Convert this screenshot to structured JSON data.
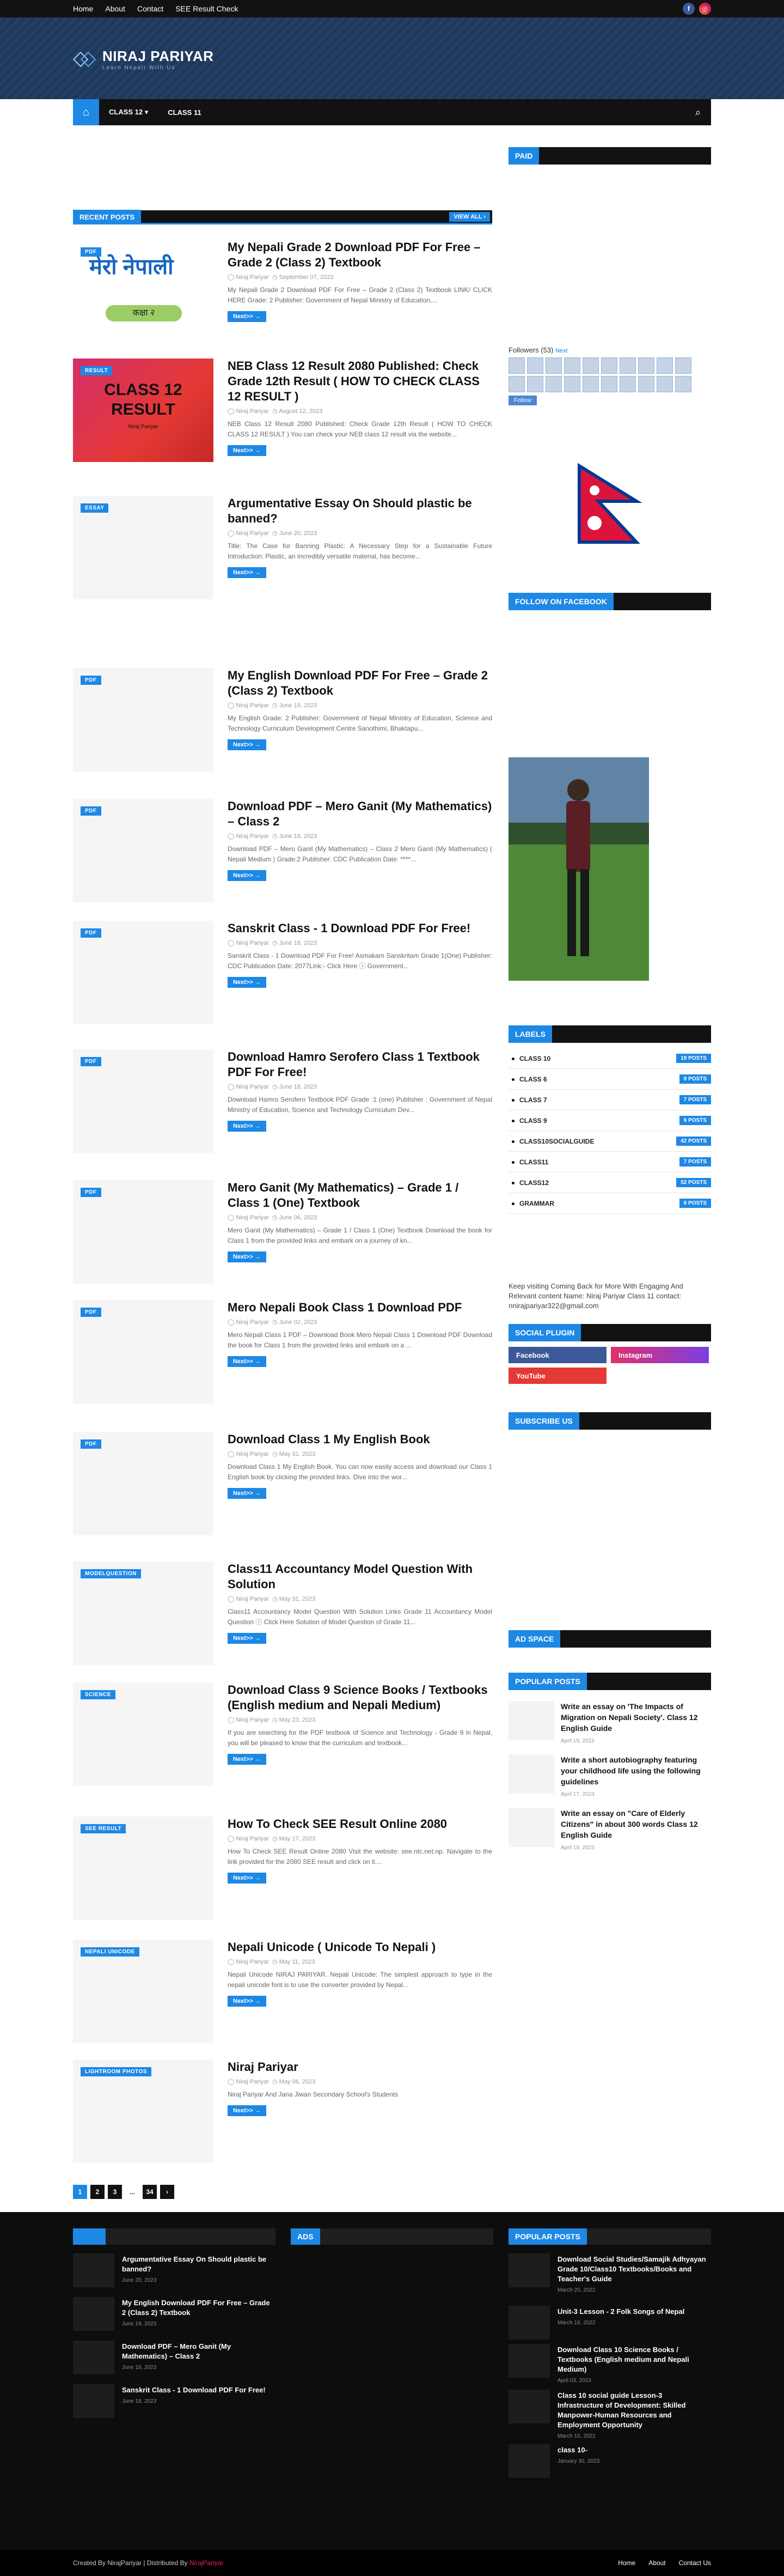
{
  "topbar": {
    "links": [
      "Home",
      "About",
      "Contact",
      "SEE Result Check"
    ],
    "social": [
      "facebook-icon",
      "instagram-icon"
    ]
  },
  "header": {
    "title": "NIRAJ PARIYAR",
    "subtitle": "Learn Nepali With Us"
  },
  "nav": {
    "items": [
      "CLASS 12 ▾",
      "CLASS 11"
    ]
  },
  "main": {
    "section_title": "RECENT POSTS",
    "view_all": "VIEW ALL ›",
    "next_label": "Next>> →",
    "posts": [
      {
        "cat": "PDF",
        "title": "My Nepali Grade 2 Download PDF For Free – Grade 2 (Class 2) Textbook",
        "author": "Niraj Pariyar",
        "date": "September 07, 2023",
        "snippet": "My Nepali Grade 2 Download PDF For Free – Grade 2 (Class 2) Textbook LINK/ CLICK HERE Grade: 2 Publisher: Government of Nepal Ministry of Education,...",
        "thumb_text": "मेरो नेपाली",
        "thumb_sub": "कक्षा २"
      },
      {
        "cat": "RESULT",
        "title": "NEB Class 12 Result 2080 Published: Check Grade 12th Result ( HOW TO CHECK CLASS 12 RESULT )",
        "author": "Niraj Pariyar",
        "date": "August 12, 2023",
        "snippet": "NEB Class 12 Result 2080 Published: Check Grade 12th Result ( HOW TO CHECK CLASS 12 RESULT ) You can check your NEB class 12 result via the website...",
        "thumb_text": "CLASS 12 RESULT",
        "thumb_sub": "Niraj Pariyar"
      },
      {
        "cat": "ESSAY",
        "title": "Argumentative Essay On Should plastic be banned?",
        "author": "Niraj Pariyar",
        "date": "June 20, 2023",
        "snippet": "Title: The Case for Banning Plastic: A Necessary Step for a Sustainable Future Introduction: Plastic, an incredibly versatile material, has become..."
      },
      {
        "cat": "PDF",
        "title": "My English Download PDF For Free – Grade 2 (Class 2) Textbook",
        "author": "Niraj Pariyar",
        "date": "June 19, 2023",
        "snippet": "My English Grade: 2 Publisher: Government of Nepal Ministry of Education, Science and Technology Curriculum Development Centre Sanothimi, Bhaktapu..."
      },
      {
        "cat": "PDF",
        "title": "Download PDF – Mero Ganit (My Mathematics) – Class 2",
        "author": "Niraj Pariyar",
        "date": "June 18, 2023",
        "snippet": "Download PDF – Mero Ganit (My Mathematics) – Class 2 Mero Ganit (My Mathematics) ( Nepali Medium ) Grade:2 Publisher: CDC Publication Date: ****..."
      },
      {
        "cat": "PDF",
        "title": "Sanskrit Class - 1 Download PDF For Free!",
        "author": "Niraj Pariyar",
        "date": "June 18, 2023",
        "snippet": "Sanskrit Class - 1 Download PDF For Free! Asmakam Sanskritam Grade 1(One) Publisher: CDC Publication Date: 2077Link:- Click Here ⓘ Government..."
      },
      {
        "cat": "PDF",
        "title": "Download Hamro Serofero Class 1 Textbook PDF For Free!",
        "author": "Niraj Pariyar",
        "date": "June 18, 2023",
        "snippet": "Download Hamro Serofero Textbook PDF Grade :1 (one) Publisher : Government of Nepal Ministry of Education, Science and Technology Curriculum Dev..."
      },
      {
        "cat": "PDF",
        "title": "Mero Ganit (My Mathematics) – Grade 1 / Class 1 (One) Textbook",
        "author": "Niraj Pariyar",
        "date": "June 06, 2023",
        "snippet": "Mero Ganit (My Mathematics) – Grade 1 / Class 1 (One) Textbook Download the book for Class 1 from the provided links and embark on a journey of kn..."
      },
      {
        "cat": "PDF",
        "title": "Mero Nepali Book Class 1 Download PDF",
        "author": "Niraj Pariyar",
        "date": "June 02, 2023",
        "snippet": "Mero Nepali Class 1 PDF – Download Book Mero Nepali Class 1 Download PDF Download the book for Class 1 from the provided links and embark on a ..."
      },
      {
        "cat": "PDF",
        "title": "Download Class 1 My English Book",
        "author": "Niraj Pariyar",
        "date": "May 31, 2023",
        "snippet": "Download Class 1 My English Book. You can now easily access and download our Class 1 English book by clicking the provided links. Dive into the wor..."
      },
      {
        "cat": "MODELQUESTION",
        "title": "Class11 Accountancy Model Question With Solution",
        "author": "Niraj Pariyar",
        "date": "May 31, 2023",
        "snippet": "Class11 Accountancy Model Question With Solution Links Grade 11 Accountancy Model Question ⓘ Click Here Solution of Model Question of Grade 11..."
      },
      {
        "cat": "SCIENCE",
        "title": "Download Class 9 Science Books / Textbooks (English medium and Nepali Medium)",
        "author": "Niraj Pariyar",
        "date": "May 23, 2023",
        "snippet": "If you are searching for the PDF textbook of Science and Technology - Grade 9 in Nepal, you will be pleased to know that the curriculum and textbook..."
      },
      {
        "cat": "SEE RESULT",
        "title": "How To Check SEE Result Online 2080",
        "author": "Niraj Pariyar",
        "date": "May 17, 2023",
        "snippet": "How To Check SEE Result Online 2080 Visit the website: see.ntc.net.np. Navigate to the link provided for the 2080 SEE result and click on it...."
      },
      {
        "cat": "NEPALI UNICODE",
        "title": "Nepali Unicode ( Unicode To Nepali )",
        "author": "Niraj Pariyar",
        "date": "May 11, 2023",
        "snippet": "Nepali Unicode NIRAJ PARIYAR. Nepali Unicode: The simplest approach to type in the nepali unicode font is to use the converter provided by Nepal..."
      },
      {
        "cat": "LIGHTROOM PHOTOS",
        "title": "Niraj Pariyar",
        "author": "Niraj Pariyar",
        "date": "May 06, 2023",
        "snippet": "Niraj Pariyar And Jana Jiwan Secondary School's Students"
      }
    ],
    "pagination": [
      "1",
      "2",
      "3",
      "...",
      "34",
      "›"
    ]
  },
  "sidebar": {
    "paid": "PAID",
    "followers_title": "Followers (53)",
    "followers_next": "Next",
    "follow_btn": "Follow",
    "fb_title": "FOLLOW ON FACEBOOK",
    "labels_title": "LABELS",
    "labels": [
      {
        "name": "CLASS 10",
        "count": "19 POSTS"
      },
      {
        "name": "CLASS 6",
        "count": "8 POSTS"
      },
      {
        "name": "CLASS 7",
        "count": "7 POSTS"
      },
      {
        "name": "CLASS 9",
        "count": "6 POSTS"
      },
      {
        "name": "CLASS10SOCIALGUIDE",
        "count": "42 POSTS"
      },
      {
        "name": "CLASS11",
        "count": "7 POSTS"
      },
      {
        "name": "CLASS12",
        "count": "52 POSTS"
      },
      {
        "name": "GRAMMAR",
        "count": "6 POSTS"
      }
    ],
    "about_text": "Keep visiting Coming Back for More With Engaging And Relevant content Name: Niraj Pariyar Class 11 contact: nnirajpariyar322@gmail.com",
    "social_title": "SOCIAL PLUGIN",
    "social": [
      "Facebook",
      "Instagram",
      "YouTube"
    ],
    "subscribe_title": "SUBSCRIBE US",
    "ad_title": "AD SPACE",
    "popular_title": "POPULAR POSTS",
    "popular": [
      {
        "title": "Write an essay on 'The Impacts of Migration on Nepali Society'. Class 12 English Guide",
        "date": "April 19, 2023"
      },
      {
        "title": "Write a short autobiography featuring your childhood life using the following guidelines",
        "date": "April 17, 2023"
      },
      {
        "title": "Write an essay on \"Care of Elderly Citizens\" in about 300 words Class 12 English Guide",
        "date": "April 19, 2023"
      }
    ]
  },
  "footer": {
    "col1": [
      {
        "title": "Argumentative Essay On Should plastic be banned?",
        "date": "June 20, 2023"
      },
      {
        "title": "My English Download PDF For Free – Grade 2 (Class 2) Textbook",
        "date": "June 19, 2023"
      },
      {
        "title": "Download PDF – Mero Ganit (My Mathematics) – Class 2",
        "date": "June 18, 2023"
      },
      {
        "title": "Sanskrit Class - 1 Download PDF For Free!",
        "date": "June 18, 2023"
      }
    ],
    "ads_title": "ADS",
    "popular_title": "POPULAR POSTS",
    "popular": [
      {
        "title": "Download Social Studies/Samajik Adhyayan Grade 10/Class10 Textbooks/Books and Teacher's Guide",
        "date": "March 20, 2022"
      },
      {
        "title": "Unit-3 Lesson - 2 Folk Songs of Nepal",
        "date": "March 16, 2022"
      },
      {
        "title": "Download Class 10 Science Books / Textbooks (English medium and Nepali Medium)",
        "date": "April 03, 2023"
      },
      {
        "title": "Class 10 social guide Lesson-3 Infrastructure of Development: Skilled Manpower-Human Resources and Employment Opportunity",
        "date": "March 10, 2022"
      },
      {
        "title": "class 10-",
        "date": "January 30, 2023"
      }
    ],
    "copyright": "Created By NirajPariyar | Distributed By",
    "distributor": "NirajPariyar",
    "links": [
      "Home",
      "About",
      "Contact Us"
    ]
  }
}
